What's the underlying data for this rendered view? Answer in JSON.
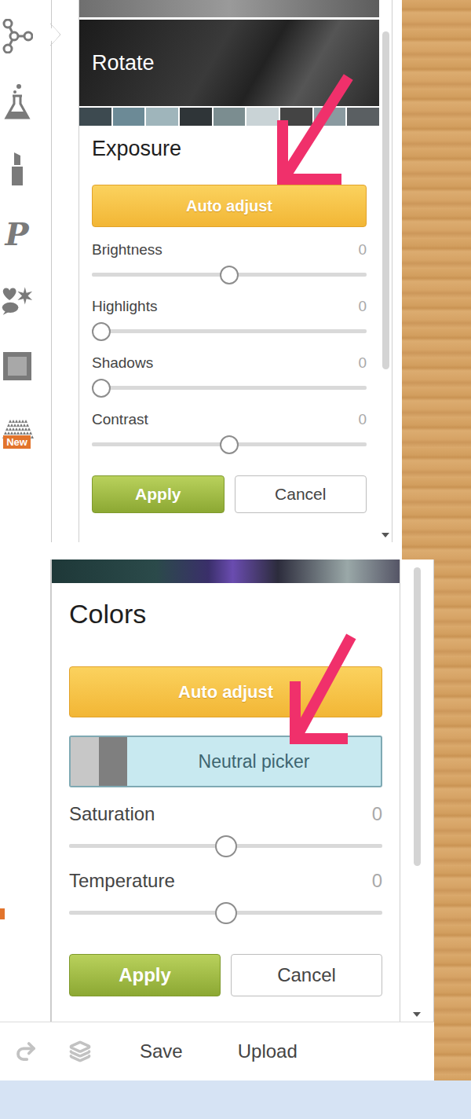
{
  "top_panel": {
    "tools": [
      {
        "kind": "basic",
        "selected": true
      },
      {
        "kind": "effects",
        "selected": false
      },
      {
        "kind": "touchup",
        "selected": false
      },
      {
        "kind": "text",
        "glyph": "P",
        "selected": false
      },
      {
        "kind": "overlays",
        "selected": false
      },
      {
        "kind": "frames",
        "selected": false
      },
      {
        "kind": "textures",
        "badge": "New",
        "selected": false
      }
    ],
    "header": "Rotate",
    "section_title": "Exposure",
    "auto_button": "Auto adjust",
    "sliders": [
      {
        "label": "Brightness",
        "value": "0",
        "level": 0.5
      },
      {
        "label": "Highlights",
        "value": "0",
        "level": 0
      },
      {
        "label": "Shadows",
        "value": "0",
        "level": 0
      },
      {
        "label": "Contrast",
        "value": "0",
        "level": 0.5
      }
    ],
    "buttons": [
      {
        "label": "Apply",
        "kind": "primary"
      },
      {
        "label": "Cancel",
        "kind": "secondary"
      }
    ]
  },
  "bottom_panel": {
    "section_title": "Colors",
    "auto_button": "Auto adjust",
    "neutral_picker": "Neutral picker",
    "sliders": [
      {
        "label": "Saturation",
        "value": "0",
        "level": 0.5
      },
      {
        "label": "Temperature",
        "value": "0",
        "level": 0.5
      }
    ],
    "buttons": [
      {
        "label": "Apply",
        "kind": "primary"
      },
      {
        "label": "Cancel",
        "kind": "secondary"
      }
    ]
  },
  "bottom_bar": {
    "actions": [
      "Save",
      "Upload"
    ]
  }
}
